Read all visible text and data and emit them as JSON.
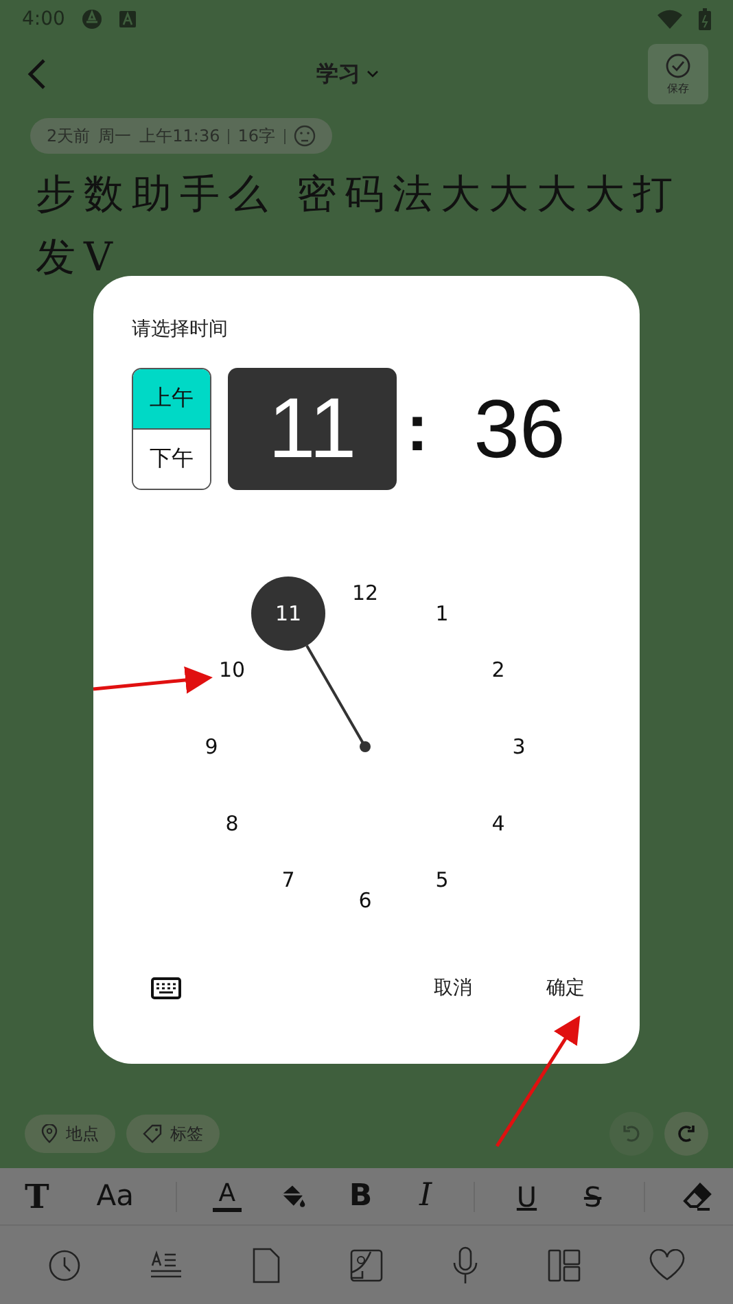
{
  "status_bar": {
    "time": "4:00"
  },
  "header": {
    "title": "学习",
    "save_label": "保存"
  },
  "meta": {
    "items": [
      "2天前",
      "周一",
      "上午11:36",
      "16字"
    ]
  },
  "note": {
    "lines": [
      "步数助手么 密码法大大大大打",
      "发V"
    ]
  },
  "dialog": {
    "title": "请选择时间",
    "periods": [
      {
        "label": "上午",
        "selected": true
      },
      {
        "label": "下午",
        "selected": false
      }
    ],
    "hour": "11",
    "separator": ":",
    "minute": "36",
    "dial": [
      {
        "label": "12",
        "selected": false
      },
      {
        "label": "1",
        "selected": false
      },
      {
        "label": "2",
        "selected": false
      },
      {
        "label": "3",
        "selected": false
      },
      {
        "label": "4",
        "selected": false
      },
      {
        "label": "5",
        "selected": false
      },
      {
        "label": "6",
        "selected": false
      },
      {
        "label": "7",
        "selected": false
      },
      {
        "label": "8",
        "selected": false
      },
      {
        "label": "9",
        "selected": false
      },
      {
        "label": "10",
        "selected": false
      },
      {
        "label": "11",
        "selected": true
      }
    ],
    "cancel": "取消",
    "confirm": "确定"
  },
  "chips": [
    {
      "kind": "location",
      "label": "地点"
    },
    {
      "kind": "tag",
      "label": "标签"
    }
  ],
  "history": {
    "undo_disabled": true,
    "redo_disabled": false
  },
  "format_toolbar": [
    {
      "kind": "text-style",
      "label": "T"
    },
    {
      "kind": "font-size",
      "label": "Aa"
    },
    {
      "kind": "divider"
    },
    {
      "kind": "text-color",
      "label": "A"
    },
    {
      "kind": "fill"
    },
    {
      "kind": "bold",
      "label": "B"
    },
    {
      "kind": "italic",
      "label": "I"
    },
    {
      "kind": "divider"
    },
    {
      "kind": "underline",
      "label": "U"
    },
    {
      "kind": "strike",
      "label": "S"
    },
    {
      "kind": "divider"
    },
    {
      "kind": "eraser"
    }
  ]
}
